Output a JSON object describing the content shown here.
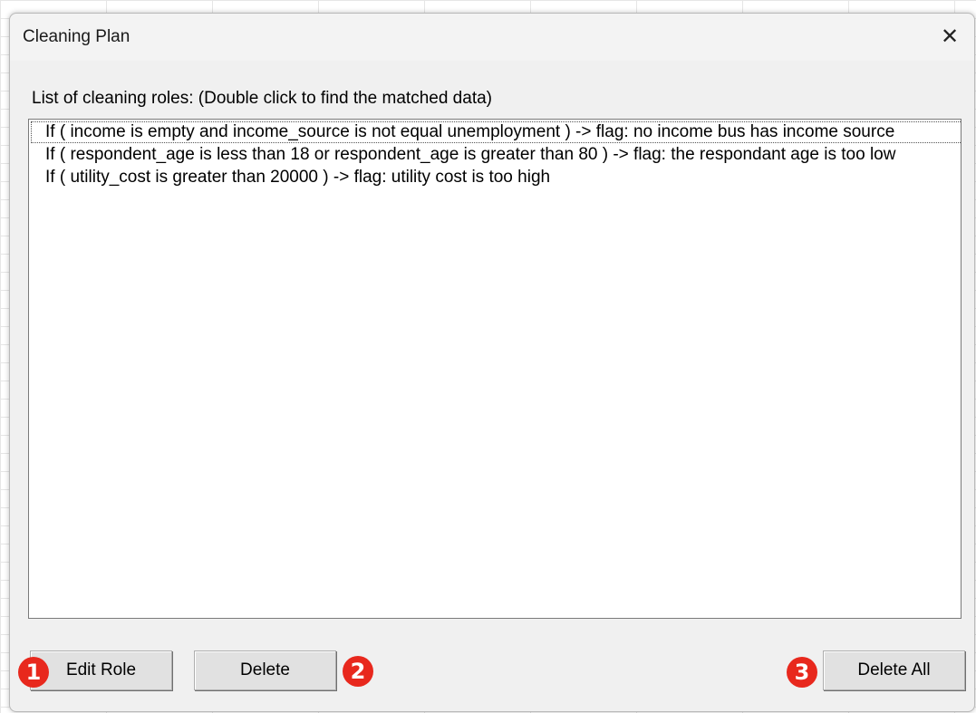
{
  "dialog": {
    "title": "Cleaning Plan",
    "close_glyph": "✕",
    "list_label": "List of cleaning roles: (Double click to find the matched data)",
    "rules": [
      "If ( income is empty and income_source is not equal unemployment ) -> flag: no income bus has income source",
      "If ( respondent_age is less than 18 or respondent_age is greater than 80 ) -> flag: the respondant age is too low",
      "If ( utility_cost is greater than 20000  ) -> flag: utility cost is too high"
    ],
    "buttons": {
      "edit_role": "Edit Role",
      "delete": "Delete",
      "delete_all": "Delete All"
    }
  },
  "annotations": {
    "badge1": "1",
    "badge2": "2",
    "badge3": "3",
    "color": "#e8281d"
  },
  "icons": {
    "close": "close-icon"
  }
}
